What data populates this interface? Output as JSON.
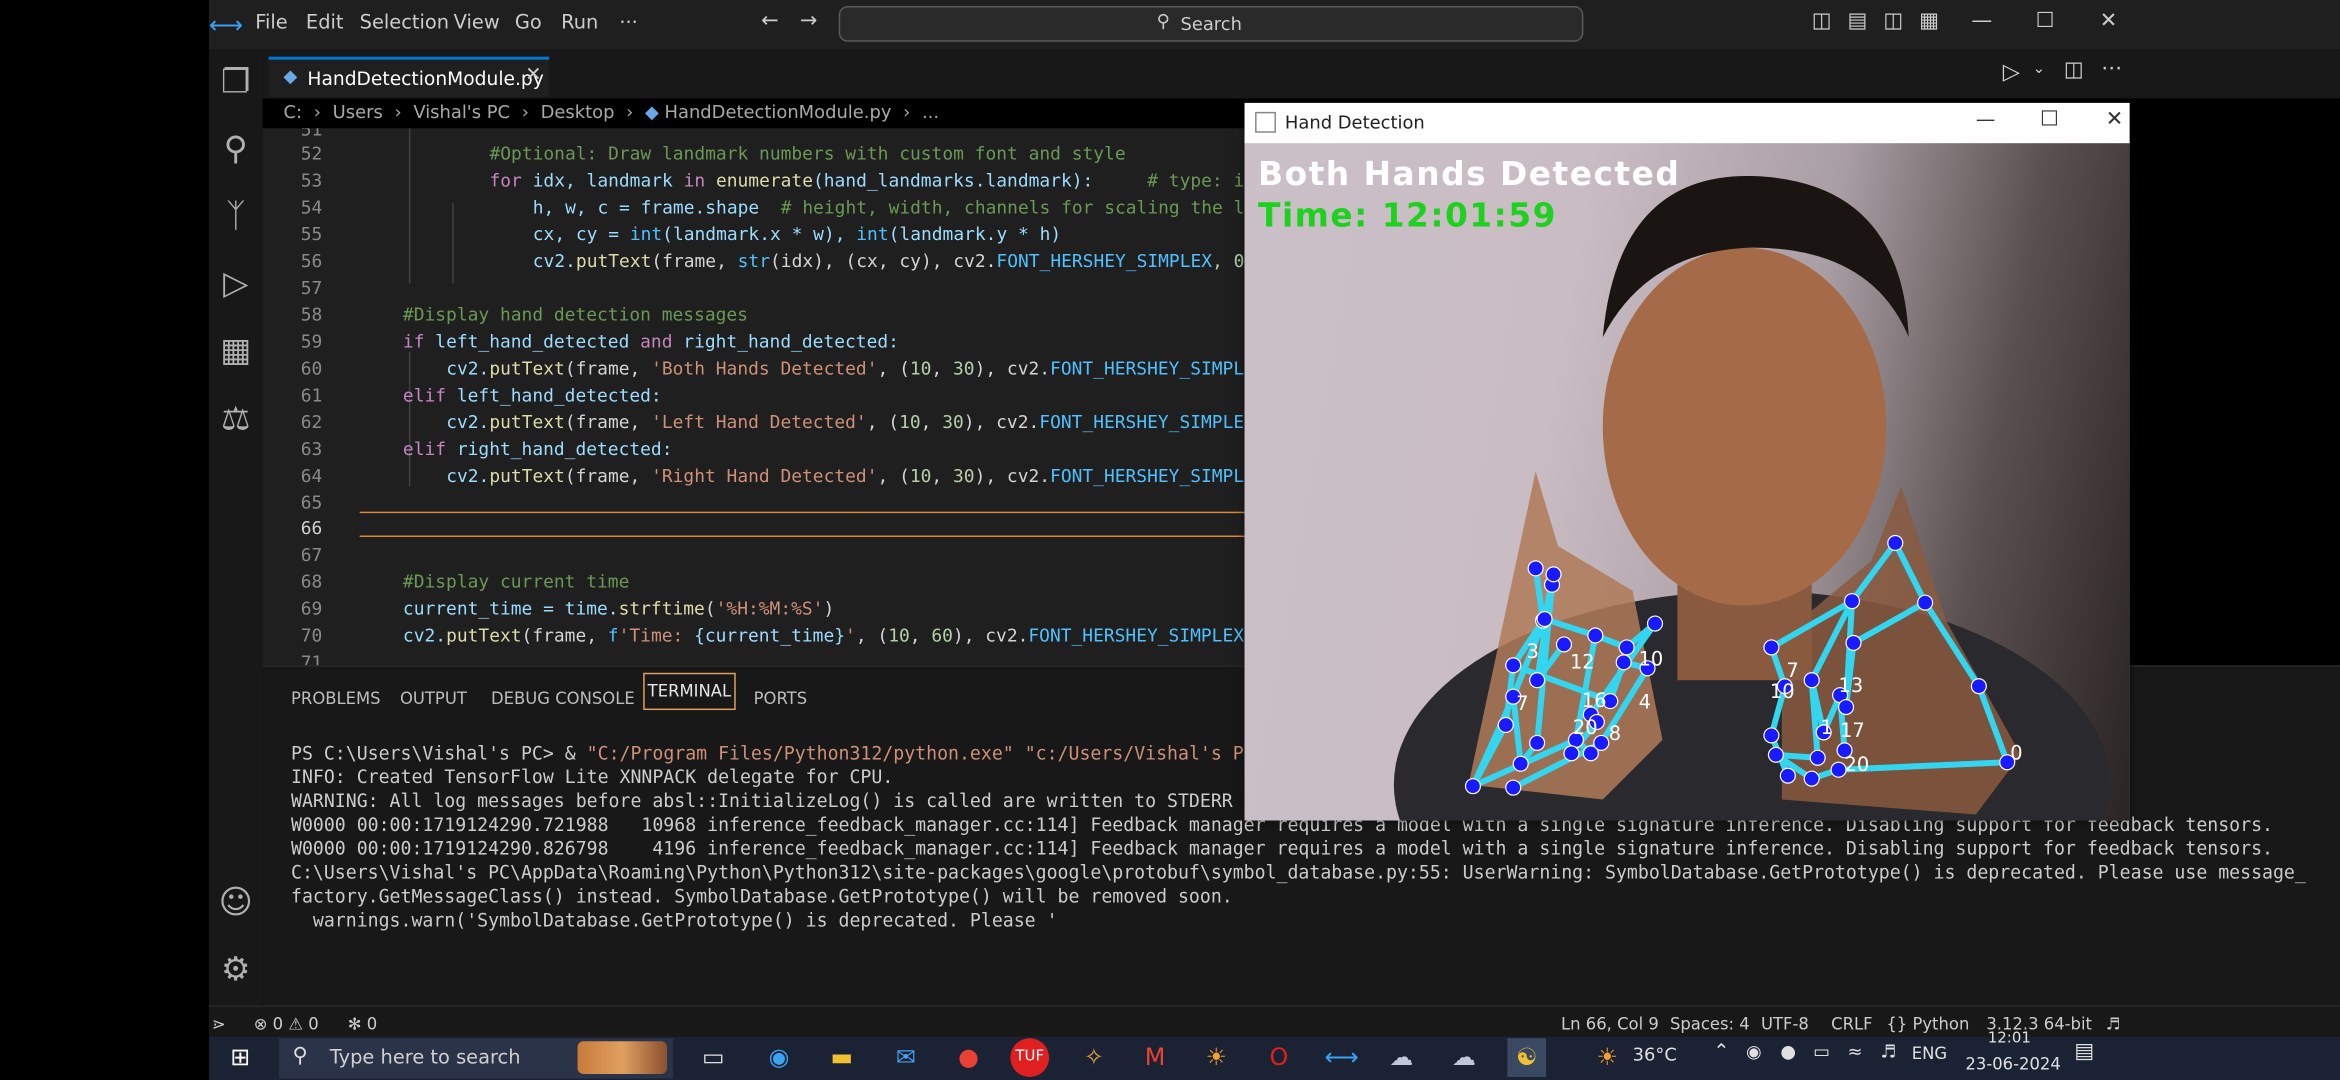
{
  "titlebar": {
    "menu": [
      "File",
      "Edit",
      "Selection",
      "View",
      "Go",
      "Run",
      "···"
    ],
    "search_label": "Search"
  },
  "editor": {
    "tab_name": "HandDetectionModule.py",
    "breadcrumbs": [
      "C:",
      "Users",
      "Vishal's PC",
      "Desktop",
      "HandDetectionModule.py",
      "..."
    ],
    "line_numbers": [
      "51",
      "52",
      "53",
      "54",
      "55",
      "56",
      "57",
      "58",
      "59",
      "60",
      "61",
      "62",
      "63",
      "64",
      "65",
      "66",
      "67",
      "68",
      "69",
      "70",
      "71"
    ],
    "code": {
      "l52": "#Optional: Draw landmark numbers with custom font and style",
      "l53_kw_for": "for",
      "l53_a": " idx, landmark ",
      "l53_kw_in": "in",
      "l53_fn": " enumerate",
      "l53_b": "(hand_landmarks.landmark):",
      "l53_cm": "     # type: i",
      "l54_a": "h, w, c = frame.shape",
      "l54_cm": "  # height, width, channels for scaling the l",
      "l55_a": "cx, cy = ",
      "l55_fn1": "int",
      "l55_b": "(landmark.x * w), ",
      "l55_fn2": "int",
      "l55_c": "(landmark.y * h)",
      "l56_a": "cv2.",
      "l56_fn": "putText",
      "l56_b": "(frame, ",
      "l56_fn2": "str",
      "l56_c": "(idx), (cx, cy), cv2.",
      "l56_cn": "FONT_HERSHEY_SIMPLEX",
      "l56_d": ", 0",
      "l58": "#Display hand detection messages",
      "l59_kw": "if",
      "l59_a": " left_hand_detected ",
      "l59_and": "and",
      "l59_b": " right_hand_detected:",
      "l60_a": "cv2.",
      "l60_fn": "putText",
      "l60_b": "(frame, ",
      "l60_st": "'Both Hands Detected'",
      "l60_c": ", (",
      "l60_n1": "10",
      "l60_d": ", ",
      "l60_n2": "30",
      "l60_e": "), cv2.",
      "l60_cn": "FONT_HERSHEY_SIMPL",
      "l61_kw": "elif",
      "l61_a": " left_hand_detected:",
      "l62_st": "'Left Hand Detected'",
      "l62_cn": "FONT_HERSHEY_SIMPLE",
      "l63_kw": "elif",
      "l63_a": " right_hand_detected:",
      "l64_st": "'Right Hand Detected'",
      "l64_cn": "FONT_HERSHEY_SIMPL",
      "l68": "#Display current time",
      "l69_a": "current_time = time.",
      "l69_fn": "strftime",
      "l69_st": "'%H:%M:%S'",
      "l70_a": "cv2.",
      "l70_fn": "putText",
      "l70_b": "(frame, ",
      "l70_f": "f",
      "l70_st1": "'Time: ",
      "l70_v": "{current_time}",
      "l70_st2": "'",
      "l70_c": ", (",
      "l70_n1": "10",
      "l70_d": ", ",
      "l70_n2": "60",
      "l70_e": "), cv2.",
      "l70_cn": "FONT_HERSHEY_SIMPLEX"
    }
  },
  "panel": {
    "tabs": [
      "PROBLEMS",
      "OUTPUT",
      "DEBUG CONSOLE",
      "TERMINAL",
      "PORTS"
    ],
    "active_tab": "TERMINAL",
    "terminal": {
      "prompt": "PS C:\\Users\\Vishal's PC> & ",
      "cmd_path1": "\"C:/Program Files/Python312/python.exe\"",
      "cmd_path2": " \"c:/Users/Vishal's PC/Desktop/",
      "lines": [
        "INFO: Created TensorFlow Lite XNNPACK delegate for CPU.",
        "WARNING: All log messages before absl::InitializeLog() is called are written to STDERR",
        "W0000 00:00:1719124290.721988   10968 inference_feedback_manager.cc:114] Feedback manager requires a model with a single signature inference. Disabling support for feedback tensors.",
        "W0000 00:00:1719124290.826798    4196 inference_feedback_manager.cc:114] Feedback manager requires a model with a single signature inference. Disabling support for feedback tensors.",
        "C:\\Users\\Vishal's PC\\AppData\\Roaming\\Python\\Python312\\site-packages\\google\\protobuf\\symbol_database.py:55: UserWarning: SymbolDatabase.GetPrototype() is deprecated. Please use message_",
        "factory.GetMessageClass() instead. SymbolDatabase.GetPrototype() will be removed soon.",
        "  warnings.warn('SymbolDatabase.GetPrototype() is deprecated. Please '"
      ]
    }
  },
  "statusbar": {
    "errors": "0",
    "warnings": "0",
    "ports": "0",
    "position": "Ln 66, Col 9",
    "spaces": "Spaces: 4",
    "encoding": "UTF-8",
    "eol": "CRLF",
    "language": "Python",
    "interpreter": "3.12.3 64-bit"
  },
  "camera_window": {
    "title": "Hand Detection",
    "overlay_status": "Both Hands Detected",
    "overlay_time": "Time: 12:01:59",
    "left_hand_labels": [
      "3",
      "12",
      "10",
      "16",
      "20",
      "8",
      "4",
      "7"
    ],
    "right_hand_labels": [
      "7",
      "10",
      "13",
      "17",
      "1",
      "20",
      "0"
    ],
    "landmark_color": "#1a1aff",
    "connection_color": "#33d6f0",
    "status_color": "#ffffff",
    "time_color": "#1fd11f"
  },
  "taskbar": {
    "search_placeholder": "Type here to search",
    "temperature": "36°C",
    "language": "ENG",
    "time": "12:01",
    "date": "23-06-2024"
  }
}
